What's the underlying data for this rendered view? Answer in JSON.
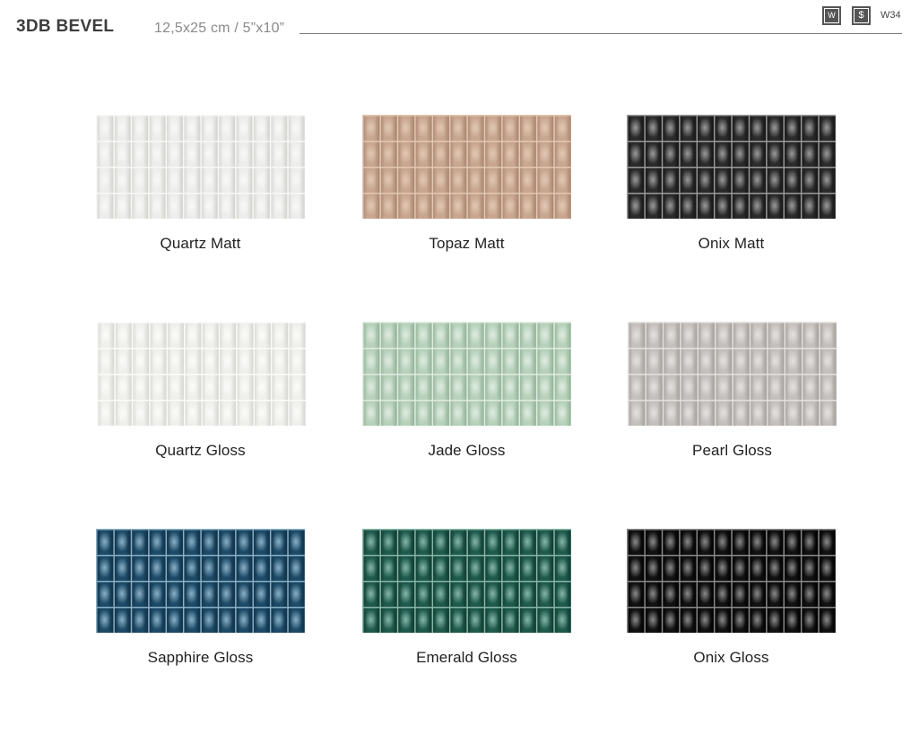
{
  "header": {
    "title": "3DB BEVEL",
    "subtitle": "12,5x25 cm / 5”x10”",
    "badges": [
      {
        "label": "W",
        "icon": "wall-icon"
      },
      {
        "label": "$",
        "icon": "price-icon"
      }
    ],
    "code": "W34"
  },
  "swatches": [
    {
      "name": "Quartz Matt",
      "color": "#ededeb",
      "line": "#f8f8f6",
      "shade": "#d2d2cf"
    },
    {
      "name": "Topaz Matt",
      "color": "#c8a68f",
      "line": "#e3c8b3",
      "shade": "#a98670"
    },
    {
      "name": "Onix Matt",
      "color": "#2b2b2b",
      "line": "#9a9a9a",
      "shade": "#151515"
    },
    {
      "name": "Quartz Gloss",
      "color": "#efefec",
      "line": "#fbfbf9",
      "shade": "#d6d6d2"
    },
    {
      "name": "Jade Gloss",
      "color": "#b7d1bb",
      "line": "#dfece0",
      "shade": "#94b39a"
    },
    {
      "name": "Pearl Gloss",
      "color": "#c4c0bd",
      "line": "#e4e1de",
      "shade": "#a5a19d"
    },
    {
      "name": "Sapphire Gloss",
      "color": "#1d4a66",
      "line": "#8ab0c6",
      "shade": "#0f3148"
    },
    {
      "name": "Emerald Gloss",
      "color": "#1f5a4c",
      "line": "#86b6a8",
      "shade": "#103c31"
    },
    {
      "name": "Onix Gloss",
      "color": "#111111",
      "line": "#8a8a8a",
      "shade": "#000000"
    }
  ]
}
